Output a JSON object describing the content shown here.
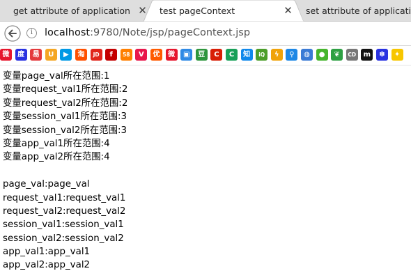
{
  "tabs": [
    {
      "title": "get attribute of application",
      "active": false
    },
    {
      "title": "test pageContext",
      "active": true
    },
    {
      "title": "set attribute of application",
      "active": false
    }
  ],
  "address_bar": {
    "host": "localhost",
    "path": ":9780/Note/jsp/pageContext.jsp"
  },
  "bookmarks": [
    {
      "icon": "weibo-icon",
      "color": "#e6162d",
      "glyph": "微"
    },
    {
      "icon": "baidu-paw-icon",
      "color": "#2932e1",
      "glyph": "度"
    },
    {
      "icon": "shop-icon",
      "color": "#e4393c",
      "glyph": "易"
    },
    {
      "icon": "u-icon",
      "color": "#f5a623",
      "glyph": "U"
    },
    {
      "icon": "video-icon",
      "color": "#0099e5",
      "glyph": "▶"
    },
    {
      "icon": "taobao-icon",
      "color": "#ff5000",
      "glyph": "淘"
    },
    {
      "icon": "jd-icon",
      "color": "#e1251b",
      "glyph": "JD"
    },
    {
      "icon": "tmall-icon",
      "color": "#c40000",
      "glyph": "f"
    },
    {
      "icon": "58-icon",
      "color": "#ff7f00",
      "glyph": "58"
    },
    {
      "icon": "vip-icon",
      "color": "#e8174b",
      "glyph": "V"
    },
    {
      "icon": "youku-icon",
      "color": "#ff5a00",
      "glyph": "优"
    },
    {
      "icon": "weibo2-icon",
      "color": "#e6162d",
      "glyph": "微"
    },
    {
      "icon": "photo-icon",
      "color": "#2f8ae5",
      "glyph": "▣"
    },
    {
      "icon": "douban-icon",
      "color": "#2e963d",
      "glyph": "豆"
    },
    {
      "icon": "c-icon",
      "color": "#d81e06",
      "glyph": "C"
    },
    {
      "icon": "c2-icon",
      "color": "#18a058",
      "glyph": "C"
    },
    {
      "icon": "zhihu-icon",
      "color": "#0f88eb",
      "glyph": "知"
    },
    {
      "icon": "infoq-icon",
      "color": "#4b9e2a",
      "glyph": "iQ"
    },
    {
      "icon": "lightning-icon",
      "color": "#f0a30a",
      "glyph": "ϟ"
    },
    {
      "icon": "network-icon",
      "color": "#1e88e5",
      "glyph": "⚲"
    },
    {
      "icon": "globe-icon",
      "color": "#3a7bd5",
      "glyph": "◍"
    },
    {
      "icon": "wechat-icon",
      "color": "#46b52d",
      "glyph": "●"
    },
    {
      "icon": "leaf-icon",
      "color": "#2ea043",
      "glyph": "❦"
    },
    {
      "icon": "cd-icon",
      "color": "#777777",
      "glyph": "CD"
    },
    {
      "icon": "m-icon",
      "color": "#111111",
      "glyph": "m"
    },
    {
      "icon": "paw-icon",
      "color": "#2932e1",
      "glyph": "✽"
    },
    {
      "icon": "bulb-icon",
      "color": "#f7c600",
      "glyph": "✦"
    }
  ],
  "scope_lines": [
    "变量page_val所在范围:1",
    "变量request_val1所在范围:2",
    "变量request_val2所在范围:2",
    "变量session_val1所在范围:3",
    "变量session_val2所在范围:3",
    "变量app_val1所在范围:4",
    "变量app_val2所在范围:4"
  ],
  "value_lines": [
    "page_val:page_val",
    "request_val1:request_val1",
    "request_val2:request_val2",
    "session_val1:session_val1",
    "session_val2:session_val2",
    "app_val1:app_val1",
    "app_val2:app_val2"
  ]
}
